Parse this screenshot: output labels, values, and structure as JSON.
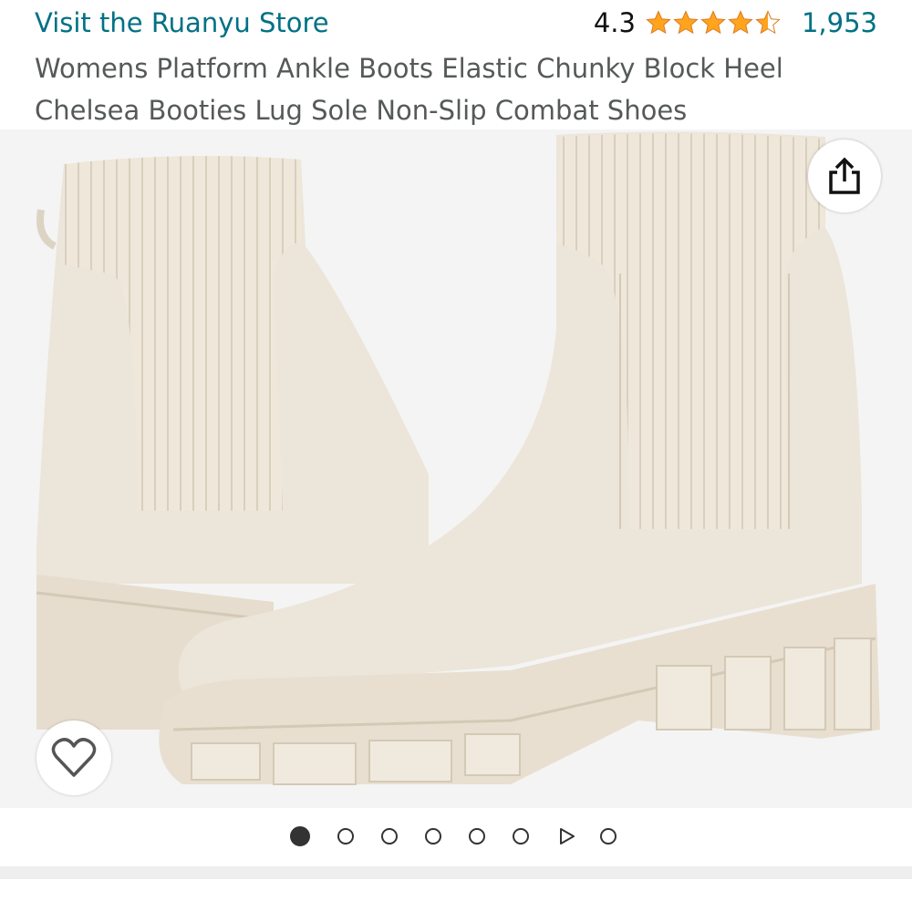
{
  "header": {
    "store_link": "Visit the Ruanyu Store",
    "rating_value": "4.3",
    "stars": [
      1,
      1,
      1,
      1,
      0.5
    ],
    "review_count": "1,953",
    "title_line1": "Womens Platform Ankle Boots Elastic Chunky Block Heel",
    "title_line2": "Chelsea Booties Lug Sole Non-Slip Combat Shoes"
  },
  "colors": {
    "link": "#007185",
    "star": "#ffa41c",
    "title": "#565959",
    "boot": "#ece5d9"
  },
  "image": {
    "description_icon": "product-photo",
    "share_icon": "share-icon",
    "heart_icon": "heart-icon"
  },
  "carousel": {
    "total": 8,
    "active_index": 0,
    "video_index": 6
  }
}
